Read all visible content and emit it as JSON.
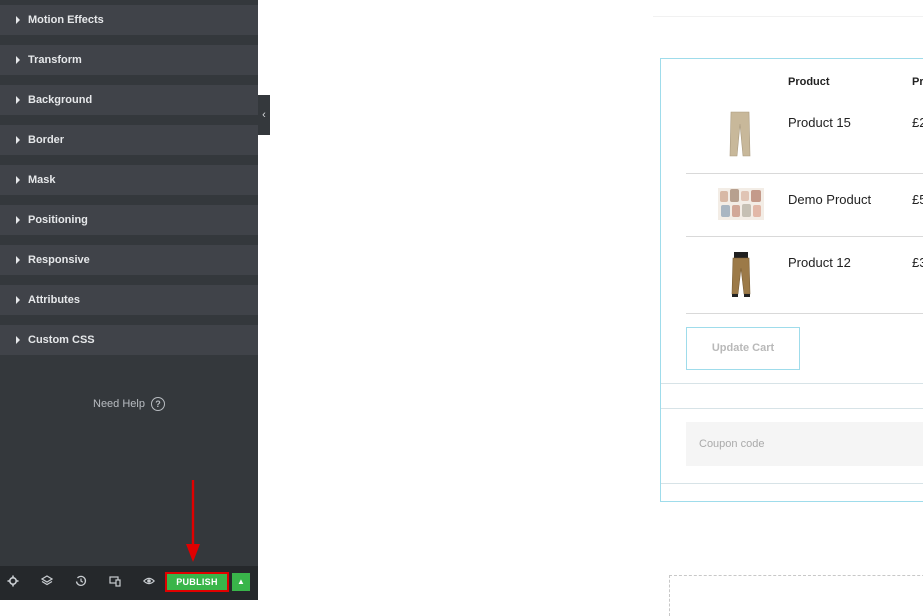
{
  "sidebar": {
    "sections": [
      {
        "label": "Motion Effects"
      },
      {
        "label": "Transform"
      },
      {
        "label": "Background"
      },
      {
        "label": "Border"
      },
      {
        "label": "Mask"
      },
      {
        "label": "Positioning"
      },
      {
        "label": "Responsive"
      },
      {
        "label": "Attributes"
      },
      {
        "label": "Custom CSS"
      }
    ],
    "help_label": "Need Help",
    "help_glyph": "?"
  },
  "footer": {
    "publish_label": "PUBLISH",
    "icons": [
      "settings-icon",
      "layers-icon",
      "history-icon",
      "responsive-icon",
      "preview-icon",
      "chevron-up-icon"
    ]
  },
  "cart": {
    "columns": [
      "Product",
      "Pr"
    ],
    "items": [
      {
        "name": "Product 15",
        "price": "£2"
      },
      {
        "name": "Demo Product",
        "price": "£5"
      },
      {
        "name": "Product 12",
        "price": "£3"
      }
    ],
    "update_label": "Update Cart",
    "coupon_placeholder": "Coupon code"
  },
  "colors": {
    "panel_bg": "#34383c",
    "section_bg": "#404349",
    "publish_green": "#39b54a",
    "annotation_red": "#e00000",
    "cart_border": "#9fdceb"
  }
}
